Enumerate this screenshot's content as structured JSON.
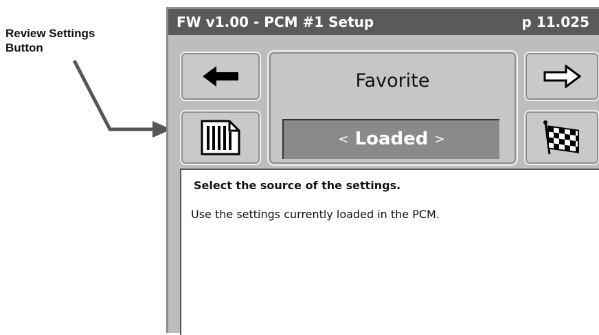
{
  "callout": {
    "line1": "Review Settings",
    "line2": "Button"
  },
  "title": {
    "left": "FW v1.00 - PCM #1 Setup",
    "page": "p 11.025"
  },
  "buttons": {
    "back_icon": "left-arrow-icon",
    "next_icon": "right-arrow-icon",
    "review_icon": "review-settings-icon",
    "finish_icon": "checkered-flag-icon"
  },
  "center": {
    "label": "Favorite",
    "selector_left": "<",
    "selector_value": "Loaded",
    "selector_right": ">"
  },
  "panel": {
    "heading": "Select the source of the settings.",
    "description": "Use the settings currently loaded in the PCM."
  },
  "colors": {
    "titlebar": "#5a5a5a",
    "screen": "#bdbdbd",
    "selector": "#8a8a8a",
    "callout_arrow": "#555555"
  }
}
